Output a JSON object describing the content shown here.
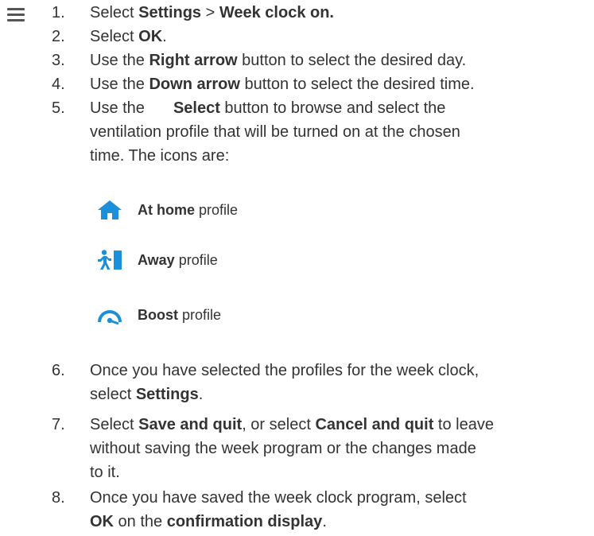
{
  "menu": {
    "icon": "hamburger-menu-icon"
  },
  "steps": [
    {
      "num": "1.",
      "parts": [
        "Select ",
        "Settings",
        " > ",
        "Week clock on."
      ]
    },
    {
      "num": "2.",
      "parts": [
        "Select ",
        "OK",
        "."
      ]
    },
    {
      "num": "3.",
      "parts": [
        "Use the ",
        "Right arrow",
        " button to select the desired day."
      ]
    },
    {
      "num": "4.",
      "parts": [
        "Use the ",
        "Down arrow",
        " button to select the desired time."
      ]
    },
    {
      "num": "5.",
      "lines": [
        "Use the",
        "Select",
        " button to browse and select the",
        "ventilation profile that will be turned on at the chosen",
        "time. The icons are:"
      ]
    },
    {
      "num": "6.",
      "lines": [
        "Once you have selected the profiles for the week clock,",
        "select ",
        "Settings",
        "."
      ]
    },
    {
      "num": "7.",
      "lines": [
        "Select ",
        "Save and quit",
        ", or select ",
        "Cancel and quit",
        " to leave",
        "without saving the week program or the changes made",
        "to it."
      ]
    },
    {
      "num": "8.",
      "lines": [
        "Once you have saved the week clock program, select",
        "OK",
        " on the ",
        "confirmation display",
        "."
      ]
    }
  ],
  "profiles": [
    {
      "icon": "home-icon",
      "name": "At home",
      "suffix": " profile"
    },
    {
      "icon": "away-icon",
      "name": "Away",
      "suffix": " profile"
    },
    {
      "icon": "boost-icon",
      "name": "Boost",
      "suffix": " profile"
    }
  ],
  "colors": {
    "icon_blue": "#1b8fd8",
    "text": "#333333"
  }
}
